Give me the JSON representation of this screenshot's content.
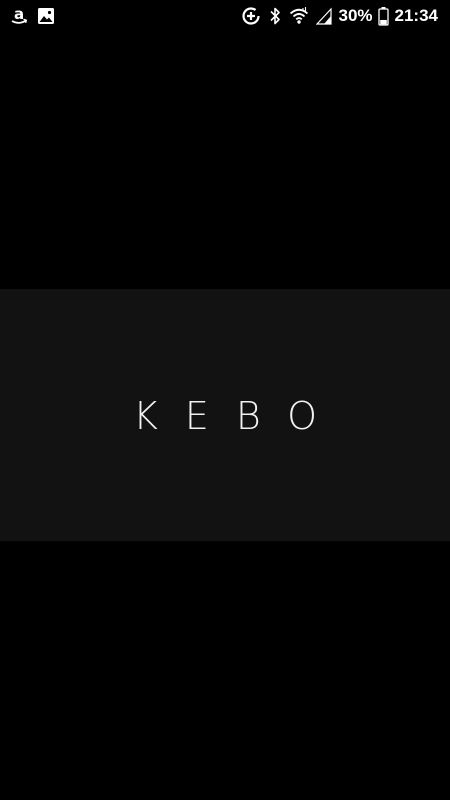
{
  "status_bar": {
    "notification_icons": [
      "amazon-icon",
      "image-icon"
    ],
    "system_icons": [
      "data-saver-icon",
      "bluetooth-icon",
      "wifi-icon",
      "cell-signal-icon",
      "battery-icon"
    ],
    "battery_percent": "30%",
    "battery_level": 0.3,
    "time": "21:34"
  },
  "splash": {
    "logo_text": "KEBO",
    "band_color": "#121212",
    "background_color": "#000000"
  }
}
